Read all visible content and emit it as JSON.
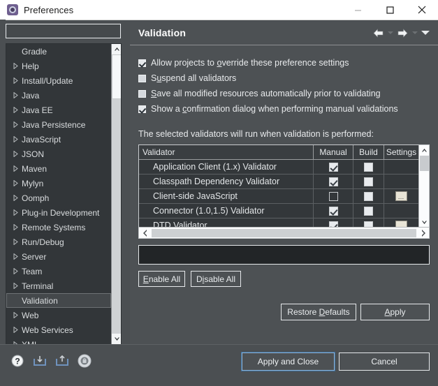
{
  "window": {
    "title": "Preferences",
    "icon": "preferences-gear-icon",
    "controls": {
      "minimize": "–",
      "maximize": "□",
      "close": "✕"
    }
  },
  "filter": {
    "value": "",
    "placeholder": ""
  },
  "tree": {
    "items": [
      {
        "label": "Gradle",
        "expandable": false,
        "selected": false
      },
      {
        "label": "Help",
        "expandable": true,
        "selected": false
      },
      {
        "label": "Install/Update",
        "expandable": true,
        "selected": false
      },
      {
        "label": "Java",
        "expandable": true,
        "selected": false
      },
      {
        "label": "Java EE",
        "expandable": true,
        "selected": false
      },
      {
        "label": "Java Persistence",
        "expandable": true,
        "selected": false
      },
      {
        "label": "JavaScript",
        "expandable": true,
        "selected": false
      },
      {
        "label": "JSON",
        "expandable": true,
        "selected": false
      },
      {
        "label": "Maven",
        "expandable": true,
        "selected": false
      },
      {
        "label": "Mylyn",
        "expandable": true,
        "selected": false
      },
      {
        "label": "Oomph",
        "expandable": true,
        "selected": false
      },
      {
        "label": "Plug-in Development",
        "expandable": true,
        "selected": false
      },
      {
        "label": "Remote Systems",
        "expandable": true,
        "selected": false
      },
      {
        "label": "Run/Debug",
        "expandable": true,
        "selected": false
      },
      {
        "label": "Server",
        "expandable": true,
        "selected": false
      },
      {
        "label": "Team",
        "expandable": true,
        "selected": false
      },
      {
        "label": "Terminal",
        "expandable": true,
        "selected": false
      },
      {
        "label": "Validation",
        "expandable": false,
        "selected": true
      },
      {
        "label": "Web",
        "expandable": true,
        "selected": false
      },
      {
        "label": "Web Services",
        "expandable": true,
        "selected": false
      },
      {
        "label": "XML",
        "expandable": true,
        "selected": false
      }
    ]
  },
  "panel": {
    "title": "Validation",
    "nav": {
      "back": "back-arrow",
      "back_menu": "back-dropdown",
      "forward": "forward-arrow",
      "forward_menu": "forward-dropdown",
      "menu": "view-menu"
    },
    "options": [
      {
        "label": "Allow projects to override these preference settings",
        "checked": true,
        "mnemonic": "o"
      },
      {
        "label": "Suspend all validators",
        "checked": false,
        "mnemonic": "u"
      },
      {
        "label": "Save all modified resources automatically prior to validating",
        "checked": false,
        "mnemonic": "S"
      },
      {
        "label": "Show a confirmation dialog when performing manual validations",
        "checked": true,
        "mnemonic": "c"
      }
    ],
    "table_label": "The selected validators will run when validation is performed:",
    "table": {
      "columns": [
        "Validator",
        "Manual",
        "Build",
        "Settings"
      ],
      "rows": [
        {
          "name": "Application Client (1.x) Validator",
          "manual": true,
          "build": false,
          "settings": false
        },
        {
          "name": "Classpath Dependency Validator",
          "manual": true,
          "build": false,
          "settings": false
        },
        {
          "name": "Client-side JavaScript",
          "manual": false,
          "build": false,
          "settings": true
        },
        {
          "name": "Connector (1.0,1.5) Validator",
          "manual": true,
          "build": false,
          "settings": false
        },
        {
          "name": "DTD Validator",
          "manual": true,
          "build": false,
          "settings": true
        }
      ],
      "settings_glyph": "…"
    },
    "description": "",
    "buttons": {
      "enable_all": "Enable All",
      "disable_all": "Disable All",
      "restore_defaults": "Restore Defaults",
      "apply": "Apply"
    }
  },
  "footer": {
    "icons": [
      {
        "name": "help-icon"
      },
      {
        "name": "import-icon"
      },
      {
        "name": "export-icon"
      },
      {
        "name": "settings-lock-icon"
      }
    ],
    "apply_and_close": "Apply and Close",
    "cancel": "Cancel"
  },
  "colors": {
    "window_bg": "#4b4f52",
    "panel_bg": "#4d5154",
    "tree_bg": "#323639",
    "table_bg": "#33373a",
    "desc_bg": "#222527",
    "text": "#e8eaec",
    "titlebar_bg": "#ffffff",
    "accent_focus": "#8fb4d6",
    "settings_btn": "#e8e4d6"
  }
}
